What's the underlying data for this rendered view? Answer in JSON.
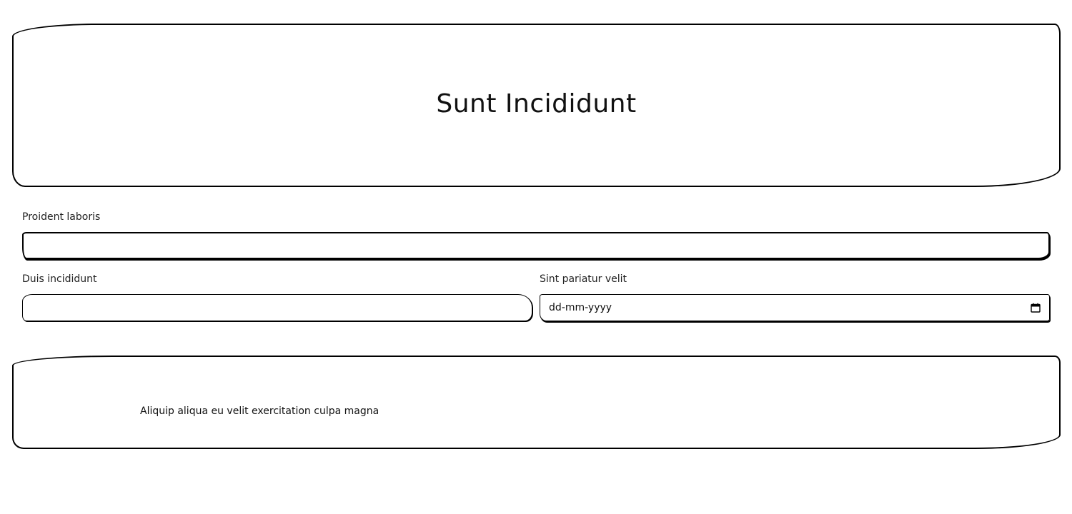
{
  "header": {
    "title": "Sunt Incididunt"
  },
  "form": {
    "field1": {
      "label": "Proident laboris",
      "value": "",
      "placeholder": ""
    },
    "field2": {
      "label": "Duis incididunt",
      "value": "",
      "placeholder": ""
    },
    "field3": {
      "label": "Sint pariatur velit",
      "placeholder": "dd-mm-yyyy",
      "icon": "calendar-icon"
    }
  },
  "footer": {
    "text": "Aliquip aliqua eu velit exercitation culpa magna"
  },
  "colors": {
    "border": "#000000",
    "background": "#ffffff",
    "text": "#111111"
  }
}
